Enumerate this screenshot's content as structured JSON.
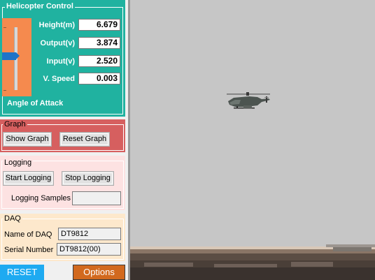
{
  "helicopter_control": {
    "title": "Helicopter Control",
    "height_label": "Height(m)",
    "height_value": "6.679",
    "output_label": "Output(v)",
    "output_value": "3.874",
    "input_label": "Input(v)",
    "input_value": "2.520",
    "vspeed_label": "V. Speed",
    "vspeed_value": "0.003",
    "angle_label": "Angle of Attack"
  },
  "graph": {
    "title": "Graph",
    "show_label": "Show Graph",
    "reset_label": "Reset Graph"
  },
  "logging": {
    "title": "Logging",
    "start_label": "Start Logging",
    "stop_label": "Stop Logging",
    "samples_label": "Logging Samples",
    "samples_value": ""
  },
  "daq": {
    "title": "DAQ",
    "name_label": "Name of DAQ",
    "name_value": "DT9812",
    "serial_label": "Serial Number",
    "serial_value": "DT9812(00)"
  },
  "footer": {
    "reset_label": "RESET",
    "options_label": "Options"
  },
  "colors": {
    "heli_panel": "#20b2a0",
    "slider_bg": "#f58a4e",
    "graph_panel": "#d65f5f",
    "logging_panel": "#fde2e2",
    "daq_panel": "#fde8cc",
    "reset_button": "#1eaaf1",
    "options_button": "#d2691e",
    "sky": "#c6c6c6"
  }
}
